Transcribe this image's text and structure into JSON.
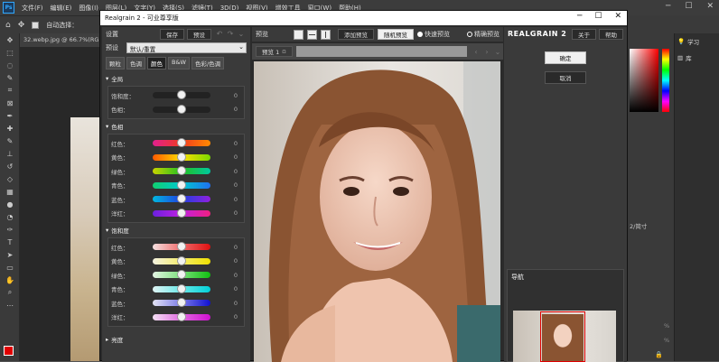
{
  "photoshop": {
    "logo": "Ps",
    "menu": [
      "文件(F)",
      "编辑(E)",
      "图像(I)",
      "图层(L)",
      "文字(Y)",
      "选择(S)",
      "滤镜(T)",
      "3D(D)",
      "视图(V)",
      "增效工具",
      "窗口(W)",
      "帮助(H)"
    ],
    "options": {
      "auto_select_label": "自动选择："
    },
    "document_tab": "32.webp.jpg @ 66.7%(RGB",
    "side_panel": {
      "learn": "学习",
      "library": "库"
    },
    "right_fragments": [
      "2/简寸",
      "%",
      "%"
    ]
  },
  "plugin": {
    "title": "Realgrain 2 - 可业尊享版",
    "settings": {
      "header": "设置",
      "save": "保存",
      "preset": "预设",
      "preset_label": "预设",
      "preset_value": "默认/重置",
      "tabs": [
        "颗粒",
        "色调",
        "颜色",
        "B&W",
        "色彩/色调"
      ],
      "active_tab_index": 2,
      "sections": [
        {
          "title": "全局",
          "rows": [
            {
              "label": "饱和度：",
              "value": "0",
              "pos": 0.5
            },
            {
              "label": "色相：",
              "value": "0",
              "pos": 0.5
            }
          ]
        },
        {
          "title": "色相",
          "rows": [
            {
              "label": "红色：",
              "value": "0",
              "pos": 0.5,
              "gradient": [
                "#e0208f",
                "#f03a20",
                "#ff8a00"
              ]
            },
            {
              "label": "黄色：",
              "value": "0",
              "pos": 0.5,
              "gradient": [
                "#ff5a00",
                "#ffe000",
                "#7ad800"
              ]
            },
            {
              "label": "绿色：",
              "value": "0",
              "pos": 0.5,
              "gradient": [
                "#c8d400",
                "#22c020",
                "#00c8a0"
              ]
            },
            {
              "label": "青色：",
              "value": "0",
              "pos": 0.5,
              "gradient": [
                "#10d070",
                "#00c8d0",
                "#2070f0"
              ]
            },
            {
              "label": "蓝色：",
              "value": "0",
              "pos": 0.5,
              "gradient": [
                "#00b8e0",
                "#2040e0",
                "#9020e0"
              ]
            },
            {
              "label": "洋红：",
              "value": "0",
              "pos": 0.5,
              "gradient": [
                "#6a20e0",
                "#c020e0",
                "#f02080"
              ]
            }
          ]
        },
        {
          "title": "饱和度",
          "rows": [
            {
              "label": "红色：",
              "value": "0",
              "pos": 0.5,
              "gradient": [
                "#f4e0e0",
                "#f06a6a",
                "#e01010"
              ]
            },
            {
              "label": "黄色：",
              "value": "0",
              "pos": 0.5,
              "gradient": [
                "#f4f2e0",
                "#f4ec6a",
                "#f0e000"
              ]
            },
            {
              "label": "绿色：",
              "value": "0",
              "pos": 0.5,
              "gradient": [
                "#e4f4e4",
                "#7ae07a",
                "#10c010"
              ]
            },
            {
              "label": "青色：",
              "value": "0",
              "pos": 0.5,
              "gradient": [
                "#e0f4f4",
                "#6ae8e8",
                "#00d0d8"
              ]
            },
            {
              "label": "蓝色：",
              "value": "0",
              "pos": 0.5,
              "gradient": [
                "#e4e4f4",
                "#7a7ae8",
                "#1010d0"
              ]
            },
            {
              "label": "洋红：",
              "value": "0",
              "pos": 0.5,
              "gradient": [
                "#f4e0f4",
                "#e06ae0",
                "#d010d0"
              ]
            }
          ]
        }
      ],
      "collapsed_section": "亮度"
    },
    "preview": {
      "label": "预览",
      "add_preview": "添加预览",
      "random_preview": "随机预览",
      "fast_preview": "快速预览",
      "precise_preview": "精确预览",
      "tab_label": "预览 1"
    },
    "right": {
      "brand": "REALGRAIN 2",
      "about": "关于",
      "help": "帮助",
      "ok": "确定",
      "cancel": "取消",
      "navigator": "导航"
    }
  }
}
